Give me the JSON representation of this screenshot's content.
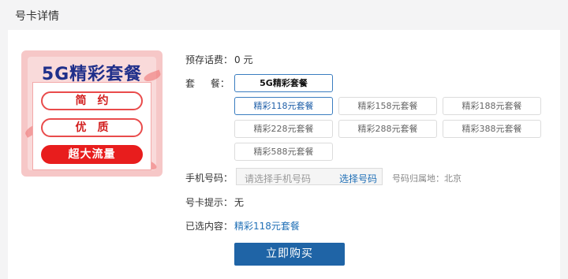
{
  "header": {
    "title": "号卡详情"
  },
  "promo": {
    "title": "5G精彩套餐",
    "tags": [
      "简约",
      "优质",
      "超大流量"
    ]
  },
  "form": {
    "prepaid_label": "预存话费：",
    "prepaid_value": "0 元",
    "package_label": "套 餐：",
    "package_type": "5G精彩套餐",
    "plans": [
      "精彩118元套餐",
      "精彩158元套餐",
      "精彩188元套餐",
      "精彩228元套餐",
      "精彩288元套餐",
      "精彩388元套餐",
      "精彩588元套餐"
    ],
    "selected_plan": "精彩118元套餐",
    "phone_label": "手机号码：",
    "phone_placeholder": "请选择手机号码",
    "phone_pick": "选择号码",
    "region_label": "号码归属地：",
    "region_value": "北京",
    "tip_label": "号卡提示：",
    "tip_value": "无",
    "selected_label": "已选内容：",
    "selected_value": "精彩118元套餐",
    "buy_button": "立即购买"
  }
}
